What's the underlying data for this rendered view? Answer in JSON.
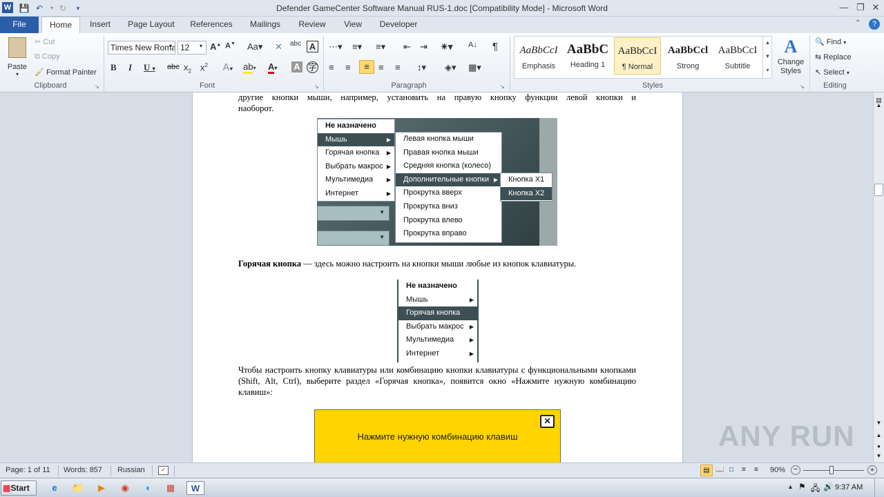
{
  "window": {
    "title": "Defender GameCenter Software Manual RUS-1.doc [Compatibility Mode]  -  Microsoft Word",
    "app_icon": "W"
  },
  "tabs": [
    "File",
    "Home",
    "Insert",
    "Page Layout",
    "References",
    "Mailings",
    "Review",
    "View",
    "Developer"
  ],
  "clipboard": {
    "paste": "Paste",
    "cut": "Cut",
    "copy": "Copy",
    "format_painter": "Format Painter",
    "label": "Clipboard"
  },
  "font": {
    "name": "Times New Roma",
    "size": "12",
    "label": "Font"
  },
  "paragraph": {
    "label": "Paragraph"
  },
  "styles": {
    "items": [
      {
        "sample": "AaBbCcI",
        "name": "Emphasis"
      },
      {
        "sample": "AaBbC",
        "name": "Heading 1"
      },
      {
        "sample": "AaBbCcI",
        "name": "¶ Normal"
      },
      {
        "sample": "AaBbCcl",
        "name": "Strong"
      },
      {
        "sample": "AaBbCcI",
        "name": "Subtitle"
      }
    ],
    "change_styles": "Change Styles",
    "label": "Styles"
  },
  "editing": {
    "find": "Find",
    "replace": "Replace",
    "select": "Select",
    "label": "Editing"
  },
  "document": {
    "top_text_1": "другие кнопки мыши, например, установить на правую кнопку функции левой кнопки и",
    "top_text_2": "наоборот.",
    "menu1": {
      "main": [
        "Не назначено",
        "Мышь",
        "Горячая кнопка",
        "Выбрать макрос",
        "Мультимедиа",
        "Интернет"
      ],
      "sub": [
        "Левая кнопка мыши",
        "Правая кнопка мыши",
        "Средняя кнопка (колесо)",
        "Дополнительные кнопки",
        "Прокрутка вверх",
        "Прокрутка вниз",
        "Прокрутка влево",
        "Прокрутка вправо"
      ],
      "sub2": [
        "Кнопка X1",
        "Кнопка X2"
      ]
    },
    "hotkey_bold": "Горячая кнопка",
    "hotkey_text": " — здесь можно настроить  на кнопки мыши любые из кнопок клавиатуры.",
    "menu2": [
      "Не назначено",
      "Мышь",
      "Горячая кнопка",
      "Выбрать макрос",
      "Мультимедиа",
      "Интернет"
    ],
    "para2": "Чтобы настроить кнопку клавиатуры или комбинацию кнопки клавиатуры с функциональными кнопками (Shift, Alt, Ctrl), выберите раздел «Горячая кнопка», появится окно «Нажмите нужную комбинацию  клавиш»:",
    "dialog_text": "Нажмите нужную комбинацию клавиш",
    "dialog_close": "✕"
  },
  "status": {
    "page": "Page: 1 of 11",
    "words": "Words: 857",
    "language": "Russian",
    "zoom": "90%"
  },
  "taskbar": {
    "start": "Start",
    "time": "9:37 AM"
  },
  "watermark": "ANY RUN",
  "colors": {
    "file_tab": "#2a5ea8",
    "highlight": "#3d4f54",
    "dialog_yellow": "#ffd400"
  }
}
